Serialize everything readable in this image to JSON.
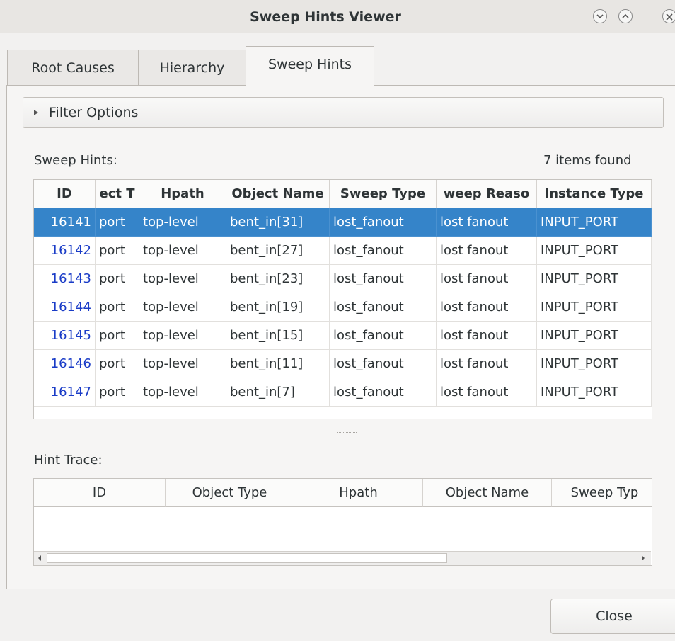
{
  "window": {
    "title": "Sweep Hints Viewer"
  },
  "tabs": [
    {
      "label": "Root Causes"
    },
    {
      "label": "Hierarchy"
    },
    {
      "label": "Sweep Hints"
    }
  ],
  "filter": {
    "label": "Filter Options"
  },
  "sweep_hints": {
    "label": "Sweep Hints:",
    "count_text": "7 items found",
    "columns": [
      "ID",
      "ect T",
      "Hpath",
      "Object Name",
      "Sweep Type",
      "weep Reaso",
      "Instance Type"
    ],
    "rows": [
      [
        "16141",
        "port",
        "top-level",
        "bent_in[31]",
        "lost_fanout",
        "lost fanout",
        "INPUT_PORT"
      ],
      [
        "16142",
        "port",
        "top-level",
        "bent_in[27]",
        "lost_fanout",
        "lost fanout",
        "INPUT_PORT"
      ],
      [
        "16143",
        "port",
        "top-level",
        "bent_in[23]",
        "lost_fanout",
        "lost fanout",
        "INPUT_PORT"
      ],
      [
        "16144",
        "port",
        "top-level",
        "bent_in[19]",
        "lost_fanout",
        "lost fanout",
        "INPUT_PORT"
      ],
      [
        "16145",
        "port",
        "top-level",
        "bent_in[15]",
        "lost_fanout",
        "lost fanout",
        "INPUT_PORT"
      ],
      [
        "16146",
        "port",
        "top-level",
        "bent_in[11]",
        "lost_fanout",
        "lost fanout",
        "INPUT_PORT"
      ],
      [
        "16147",
        "port",
        "top-level",
        "bent_in[7]",
        "lost_fanout",
        "lost fanout",
        "INPUT_PORT"
      ]
    ]
  },
  "hint_trace": {
    "label": "Hint Trace:",
    "columns": [
      "ID",
      "Object Type",
      "Hpath",
      "Object Name",
      "Sweep Typ"
    ]
  },
  "buttons": {
    "close": "Close"
  },
  "colors": {
    "selection": "#3584c9",
    "id_link": "#1a3cc7"
  }
}
